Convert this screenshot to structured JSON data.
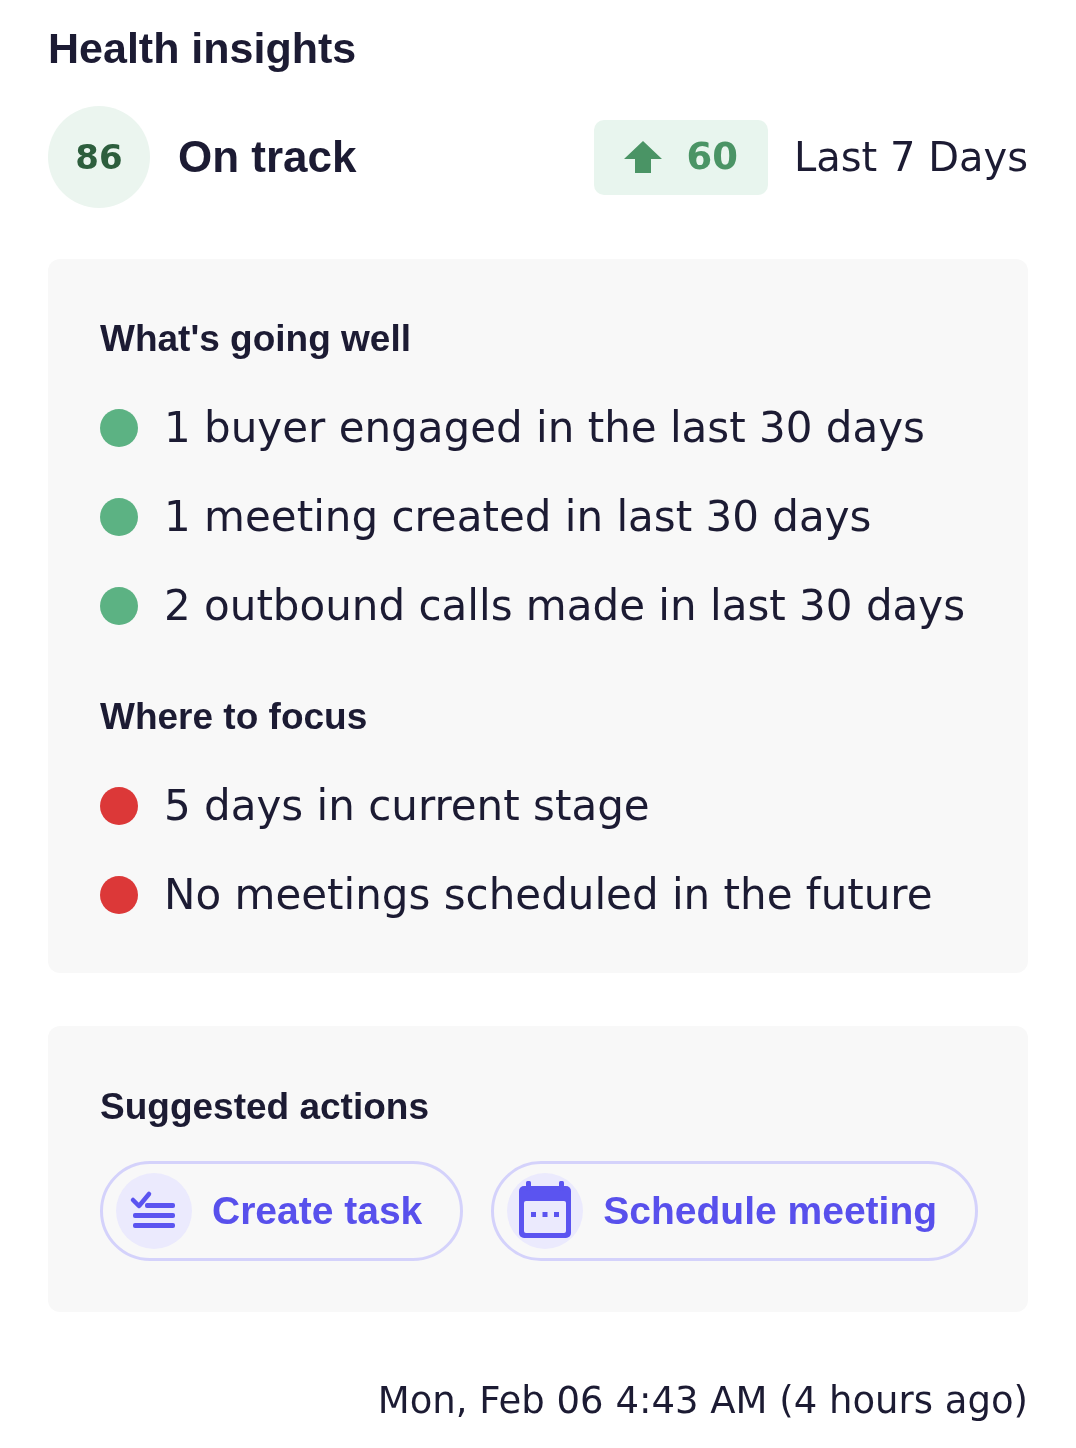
{
  "title": "Health insights",
  "score": {
    "value": "86",
    "label": "On track"
  },
  "trend": {
    "value": "60",
    "period": "Last 7 Days"
  },
  "sections": [
    {
      "heading": "What's going well",
      "items": [
        {
          "text": "1 buyer engaged in the last 30 days",
          "color": "#5cb283"
        },
        {
          "text": "1 meeting created in last 30 days",
          "color": "#5cb283"
        },
        {
          "text": "2 outbound calls made in last 30 days",
          "color": "#5cb283"
        }
      ]
    },
    {
      "heading": "Where to focus",
      "items": [
        {
          "text": "5 days in current stage",
          "color": "#dc3838"
        },
        {
          "text": "No meetings scheduled in the future",
          "color": "#dc3838"
        }
      ]
    }
  ],
  "actions": {
    "heading": "Suggested actions",
    "buttons": [
      {
        "kind": "task",
        "label": "Create task"
      },
      {
        "kind": "meeting",
        "label": "Schedule meeting"
      }
    ]
  },
  "timestamp": "Mon, Feb 06 4:43 AM (4 hours ago)"
}
